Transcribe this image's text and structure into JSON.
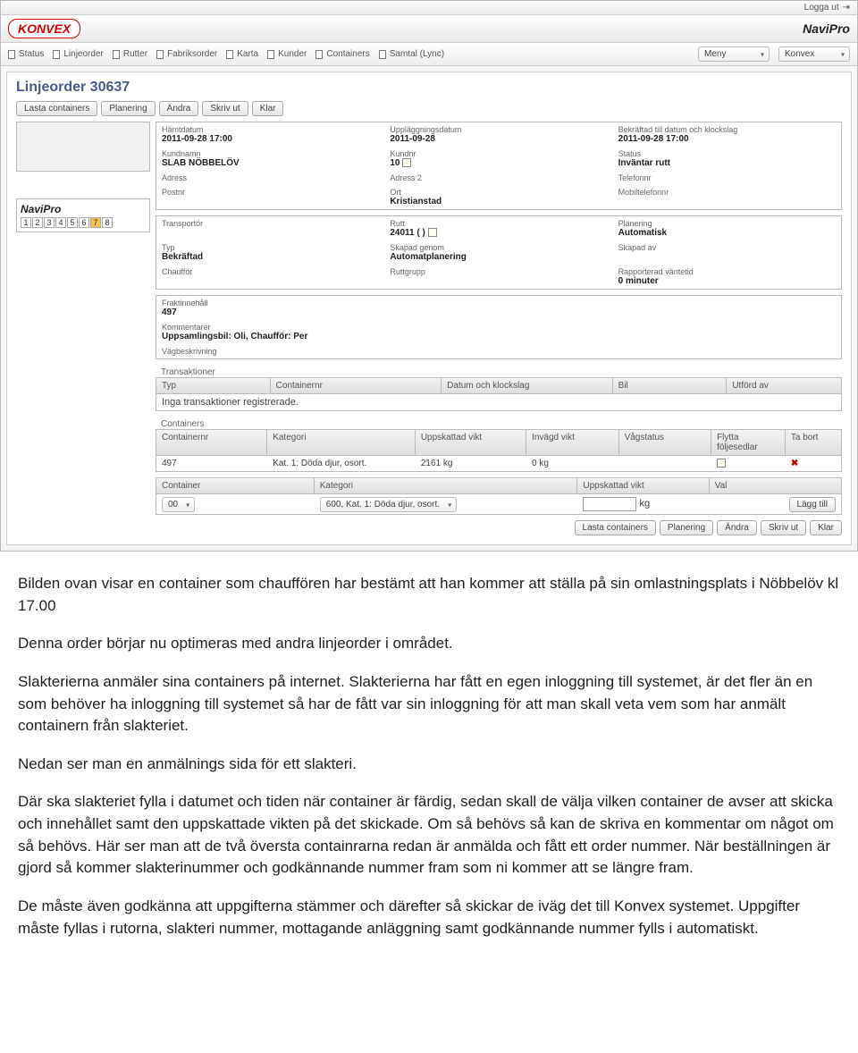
{
  "topbar": {
    "logout": "Logga ut"
  },
  "logos": {
    "konvex": "KONVEX",
    "navipro": "NaviPro"
  },
  "nav": {
    "items": [
      "Status",
      "Linjeorder",
      "Rutter",
      "Fabriksorder",
      "Karta",
      "Kunder",
      "Containers",
      "Samtal (Lync)"
    ],
    "menu_label": "Meny",
    "context_label": "Konvex"
  },
  "page": {
    "title": "Linjeorder 30637",
    "buttons": {
      "lasta": "Lasta containers",
      "planering": "Planering",
      "andra": "Ändra",
      "skrivut": "Skriv ut",
      "klar": "Klar"
    }
  },
  "pager": {
    "pages": [
      "1",
      "2",
      "3",
      "4",
      "5",
      "6",
      "7",
      "8"
    ],
    "active": 6
  },
  "section1": {
    "hamtdatum_lbl": "Hämtdatum",
    "hamtdatum": "2011-09-28 17:00",
    "upplaggning_lbl": "Uppläggningsdatum",
    "upplaggning": "2011-09-28",
    "bekraftad_lbl": "Bekräftad till datum och klockslag",
    "bekraftad": "2011-09-28 17:00",
    "kundnamn_lbl": "Kundnamn",
    "kundnamn": "SLAB NÖBBELÖV",
    "kundnr_lbl": "Kundnr",
    "kundnr": "10",
    "status_lbl": "Status",
    "status": "Inväntar rutt",
    "adress_lbl": "Adress",
    "adress2_lbl": "Adress 2",
    "telefon_lbl": "Telefonnr",
    "postnr_lbl": "Postnr",
    "ort_lbl": "Ort",
    "ort": "Kristianstad",
    "mobil_lbl": "Mobiltelefonnr"
  },
  "section2": {
    "transportor_lbl": "Transportör",
    "rutt_lbl": "Rutt",
    "rutt": "24011 ( )",
    "planering_lbl": "Planering",
    "planering": "Automatisk",
    "typ_lbl": "Typ",
    "typ": "Bekräftad",
    "skapad_genom_lbl": "Skapad genom",
    "skapad_genom": "Automatplanering",
    "skapad_av_lbl": "Skapad av",
    "chauffor_lbl": "Chaufför",
    "ruttgrupp_lbl": "Ruttgrupp",
    "rapporterad_lbl": "Rapporterad väntetid",
    "rapporterad": "0 minuter"
  },
  "section3": {
    "fraktinnehall_lbl": "Fraktinnehåll",
    "fraktinnehall": "497",
    "kommentarer_lbl": "Kommentarer",
    "kommentarer": "Uppsamlingsbil: Oli, Chaufför: Per",
    "vagbeskrivning_lbl": "Vägbeskrivning"
  },
  "transactions": {
    "title": "Transaktioner",
    "cols": [
      "Typ",
      "Containernr",
      "Datum och klockslag",
      "Bil",
      "Utförd av"
    ],
    "empty": "Inga transaktioner registrerade."
  },
  "containers": {
    "title": "Containers",
    "cols": [
      "Containernr",
      "Kategori",
      "Uppskattad vikt",
      "Invägd vikt",
      "Vågstatus",
      "Flytta följesedlar",
      "Ta bort"
    ],
    "rows": [
      {
        "nr": "497",
        "kat": "Kat. 1: Döda djur, osort.",
        "uppskattad": "2161 kg",
        "invagd": "0 kg"
      }
    ]
  },
  "addcontainer": {
    "cols": [
      "Container",
      "Kategori",
      "Uppskattad vikt",
      "Val"
    ],
    "container": "00",
    "kategori": "600, Kat. 1: Döda djur, osort.",
    "vikt_suffix": "kg",
    "lagg_till": "Lägg till"
  },
  "doc": {
    "p1": "Bilden ovan visar en container som chauffören har bestämt att han kommer att ställa på sin omlastningsplats i Nöbbelöv kl 17.00",
    "p2": "Denna order börjar nu optimeras med andra linjeorder i området.",
    "p3": "Slakterierna anmäler sina containers på internet. Slakterierna har fått en egen inloggning till systemet, är det fler än en som behöver ha inloggning till systemet så har de fått var sin inloggning för att man skall veta vem som har anmält containern från slakteriet.",
    "p4": "Nedan ser man en anmälnings sida för ett slakteri.",
    "p5": "Där ska slakteriet fylla i datumet och tiden när container är färdig, sedan skall de välja vilken container de avser att skicka och innehållet samt den uppskattade vikten på det skickade. Om så behövs så kan de skriva en kommentar om något om så behövs. Här ser man att de två översta containrarna redan är anmälda och fått ett order nummer. När beställningen är gjord så kommer slakterinummer och godkännande nummer fram som ni kommer att se längre fram.",
    "p6": "De måste även godkänna att uppgifterna stämmer och därefter så skickar de iväg det till Konvex systemet. Uppgifter måste fyllas i rutorna, slakteri nummer, mottagande anläggning samt godkännande nummer fylls i automatiskt."
  }
}
